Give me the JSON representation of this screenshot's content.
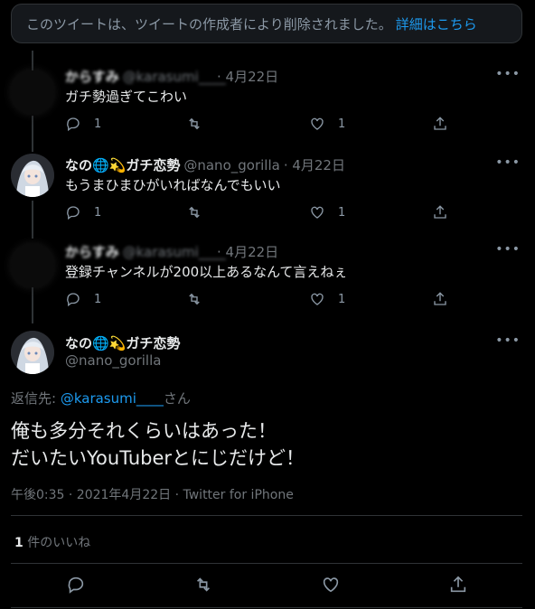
{
  "deleted_notice": {
    "text": "このツイートは、ツイートの作成者により削除されました。",
    "link": "詳細はこちら"
  },
  "tweets": [
    {
      "name": "からすみ",
      "handle": "@karasumi____",
      "date": "· 4月22日",
      "text": "ガチ勢過ぎてこわい",
      "replies": "1",
      "retweets": "",
      "likes": "1",
      "blurred": true
    },
    {
      "name": "なの🌐💫ガチ恋勢",
      "handle": "@nano_gorilla",
      "date": "· 4月22日",
      "text": "もうまひまひがいればなんでもいい",
      "replies": "1",
      "retweets": "",
      "likes": "1",
      "blurred": false
    },
    {
      "name": "からすみ",
      "handle": "@karasumi____",
      "date": "· 4月22日",
      "text": "登録チャンネルが200以上あるなんて言えねぇ",
      "replies": "1",
      "retweets": "",
      "likes": "1",
      "blurred": true
    }
  ],
  "main_tweet": {
    "name": "なの🌐💫ガチ恋勢",
    "handle": "@nano_gorilla",
    "reply_prefix": "返信先: ",
    "reply_mention": "@karasumi____",
    "reply_suffix": "さん",
    "line1": "俺も多分それくらいはあった！",
    "line2": "だいたいYouTuberとにじだけど！",
    "meta": "午後0:35 · 2021年4月22日 · Twitter for iPhone",
    "like_count": "1",
    "like_label": " 件のいいね"
  },
  "icons": [
    "reply-icon",
    "retweet-icon",
    "like-icon",
    "share-icon",
    "more-icon"
  ]
}
